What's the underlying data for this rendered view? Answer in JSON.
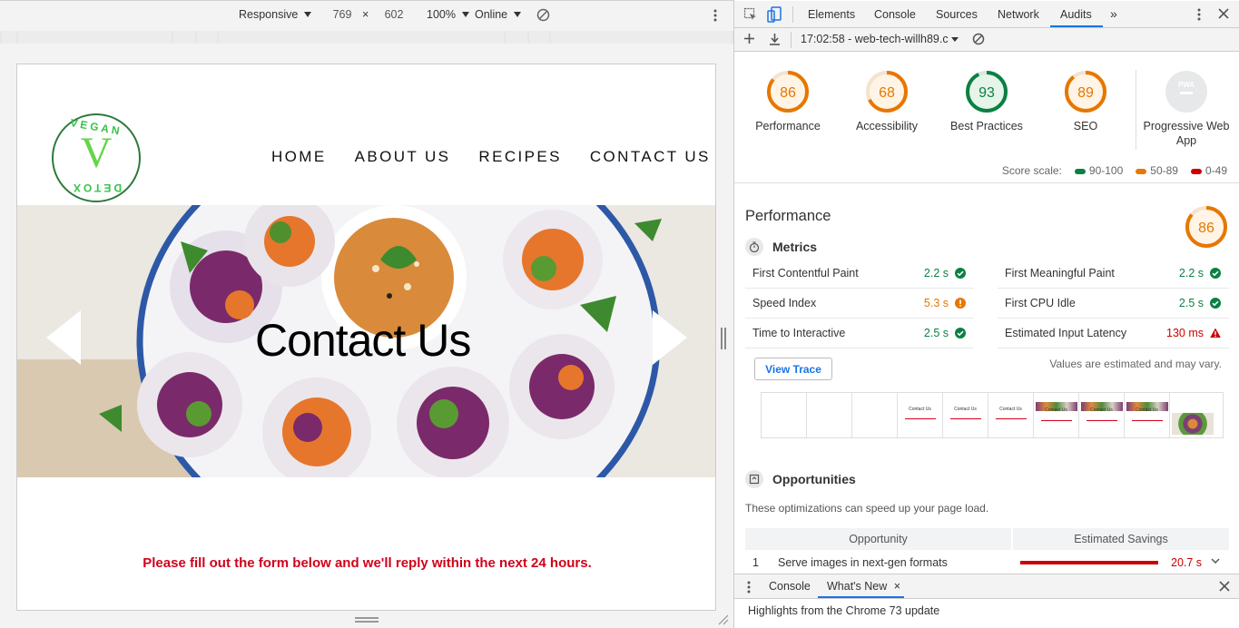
{
  "device_toolbar": {
    "device": "Responsive",
    "width": "769",
    "height": "602",
    "zoom": "100%",
    "throttling": "Online"
  },
  "site": {
    "logo_top": "VEGAN",
    "logo_letter": "V",
    "logo_bottom": "DETOX",
    "nav": [
      "HOME",
      "ABOUT US",
      "RECIPES",
      "CONTACT US"
    ],
    "hero_title": "Contact Us",
    "form_note": "Please fill out the form below and we'll reply within the next 24 hours."
  },
  "devtools": {
    "tabs": [
      "Elements",
      "Console",
      "Sources",
      "Network",
      "Audits"
    ],
    "active_tab": "Audits",
    "more": "»",
    "report_label": "17:02:58 - web-tech-willh89.c",
    "categories": [
      {
        "label": "Performance",
        "score": "86",
        "value": 86,
        "color": "#e67700"
      },
      {
        "label": "Accessibility",
        "score": "68",
        "value": 68,
        "color": "#e67700"
      },
      {
        "label": "Best Practices",
        "score": "93",
        "value": 93,
        "color": "#0b8043"
      },
      {
        "label": "SEO",
        "score": "89",
        "value": 89,
        "color": "#e67700"
      },
      {
        "label_line1": "Progressive Web",
        "label_line2": "App",
        "badge": "PWA"
      }
    ],
    "score_scale": {
      "label": "Score scale:",
      "ranges": [
        {
          "text": "90-100",
          "color": "#0b8043"
        },
        {
          "text": "50-89",
          "color": "#e67700"
        },
        {
          "text": "0-49",
          "color": "#cc0000"
        }
      ]
    },
    "performance": {
      "title": "Performance",
      "score": "86",
      "value": 86,
      "metrics_heading": "Metrics",
      "metrics": [
        {
          "name": "First Contentful Paint",
          "value": "2.2 s",
          "status": "pass"
        },
        {
          "name": "First Meaningful Paint",
          "value": "2.2 s",
          "status": "pass"
        },
        {
          "name": "Speed Index",
          "value": "5.3 s",
          "status": "average"
        },
        {
          "name": "First CPU Idle",
          "value": "2.5 s",
          "status": "pass"
        },
        {
          "name": "Time to Interactive",
          "value": "2.5 s",
          "status": "pass"
        },
        {
          "name": "Estimated Input Latency",
          "value": "130 ms",
          "status": "fail"
        }
      ],
      "view_trace": "View Trace",
      "estimate_note": "Values are estimated and may vary.",
      "frame_title": "Contact Us"
    },
    "opportunities": {
      "heading": "Opportunities",
      "description": "These optimizations can speed up your page load.",
      "col_opportunity": "Opportunity",
      "col_savings": "Estimated Savings",
      "rows": [
        {
          "index": "1",
          "title": "Serve images in next-gen formats",
          "savings": "20.7 s"
        }
      ]
    },
    "drawer": {
      "tabs": [
        "Console",
        "What's New"
      ],
      "active": "What's New",
      "body": "Highlights from the Chrome 73 update"
    }
  }
}
